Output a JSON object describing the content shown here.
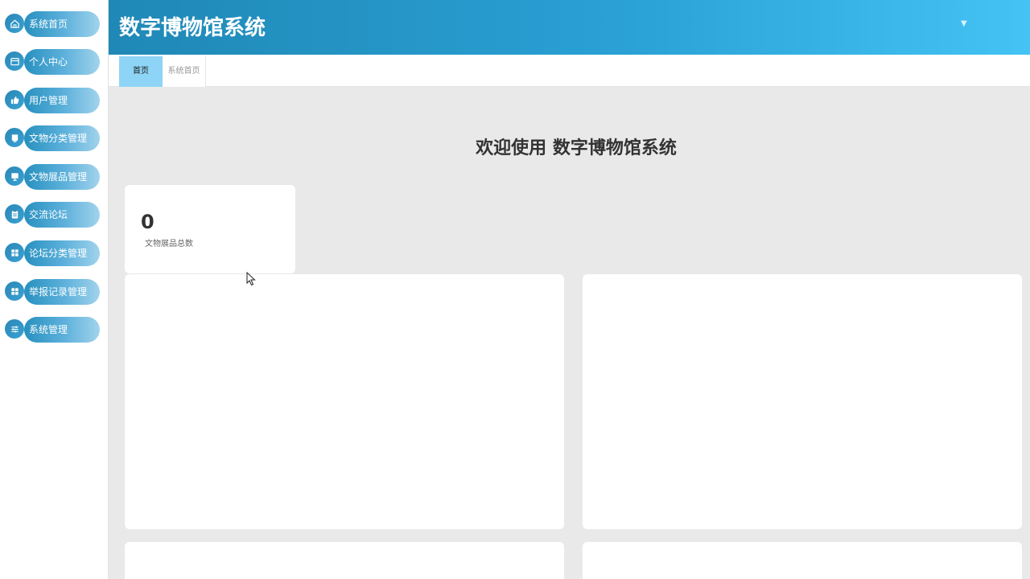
{
  "app": {
    "title": "数字博物馆系统"
  },
  "header": {
    "dropdown_symbol": "▼"
  },
  "sidebar": {
    "items": [
      {
        "label": "系统首页",
        "icon": "home-icon"
      },
      {
        "label": "个人中心",
        "icon": "wallet-icon"
      },
      {
        "label": "用户管理",
        "icon": "thumb-up-icon"
      },
      {
        "label": "文物分类管理",
        "icon": "cup-icon"
      },
      {
        "label": "文物展品管理",
        "icon": "monitor-icon"
      },
      {
        "label": "交流论坛",
        "icon": "clipboard-icon"
      },
      {
        "label": "论坛分类管理",
        "icon": "grid-icon"
      },
      {
        "label": "举报记录管理",
        "icon": "grid-icon"
      },
      {
        "label": "系统管理",
        "icon": "sliders-icon"
      }
    ]
  },
  "tabs": [
    {
      "label": "首页",
      "active": true
    },
    {
      "label": "系统首页",
      "active": false
    }
  ],
  "main": {
    "welcome": "欢迎使用 数字博物馆系统",
    "stat": {
      "value": "0",
      "label": "文物展品总数"
    }
  },
  "colors": {
    "accent": "#2aa0d4",
    "active_tab": "#8dd4f6",
    "background": "#e9e9e9"
  }
}
